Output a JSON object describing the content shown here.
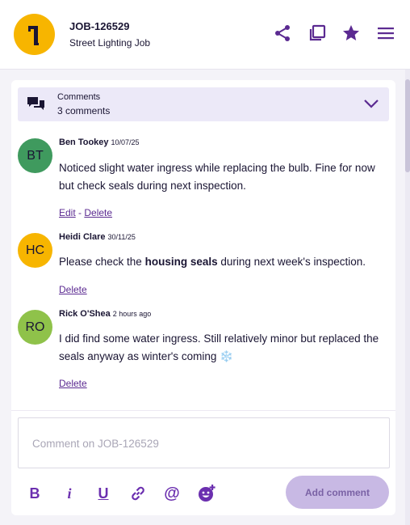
{
  "job": {
    "id": "JOB-126529",
    "title": "Street Lighting Job",
    "icon": "street-lamp-icon"
  },
  "header_actions": [
    {
      "name": "share",
      "icon": "share-icon"
    },
    {
      "name": "duplicate",
      "icon": "duplicate-icon"
    },
    {
      "name": "favourite",
      "icon": "star-icon"
    },
    {
      "name": "menu",
      "icon": "hamburger-menu-icon"
    }
  ],
  "comments_section": {
    "label": "Comments",
    "count_text": "3 comments",
    "icon": "chat-bubbles-icon",
    "toggle_icon": "chevron-down-icon"
  },
  "comments": [
    {
      "initials": "BT",
      "avatar_color": "#3f9a5e",
      "author": "Ben Tookey",
      "time": "10/07/25",
      "text": "Noticed slight water ingress while replacing the bulb. Fine for now but check seals during next inspection.",
      "actions": {
        "edit": "Edit",
        "separator": " - ",
        "delete": "Delete"
      }
    },
    {
      "initials": "HC",
      "avatar_color": "#f7b500",
      "author": "Heidi Clare",
      "time": "30/11/25",
      "text_before": "Please check the ",
      "text_bold": "housing seals",
      "text_after": " during next week's inspection.",
      "actions": {
        "delete": "Delete"
      }
    },
    {
      "initials": "RO",
      "avatar_color": "#8fc24a",
      "author": "Rick O'Shea",
      "time": "2 hours ago",
      "text": "I did find some water ingress. Still relatively minor but replaced the seals anyway as winter's coming",
      "emoji": "❄️",
      "actions": {
        "delete": "Delete"
      }
    }
  ],
  "editor": {
    "placeholder": "Comment on JOB-126529",
    "toolbar": [
      {
        "name": "bold",
        "glyph": "B"
      },
      {
        "name": "italic",
        "glyph": "i"
      },
      {
        "name": "underline",
        "glyph": "U"
      },
      {
        "name": "link",
        "icon": "link-icon"
      },
      {
        "name": "mention",
        "glyph": "@"
      },
      {
        "name": "emoji",
        "icon": "add-emoji-icon"
      }
    ],
    "submit_label": "Add comment"
  },
  "colors": {
    "accent": "#5b2a91",
    "job_avatar": "#f7b500",
    "submit_disabled_bg": "#c8b9e4"
  }
}
